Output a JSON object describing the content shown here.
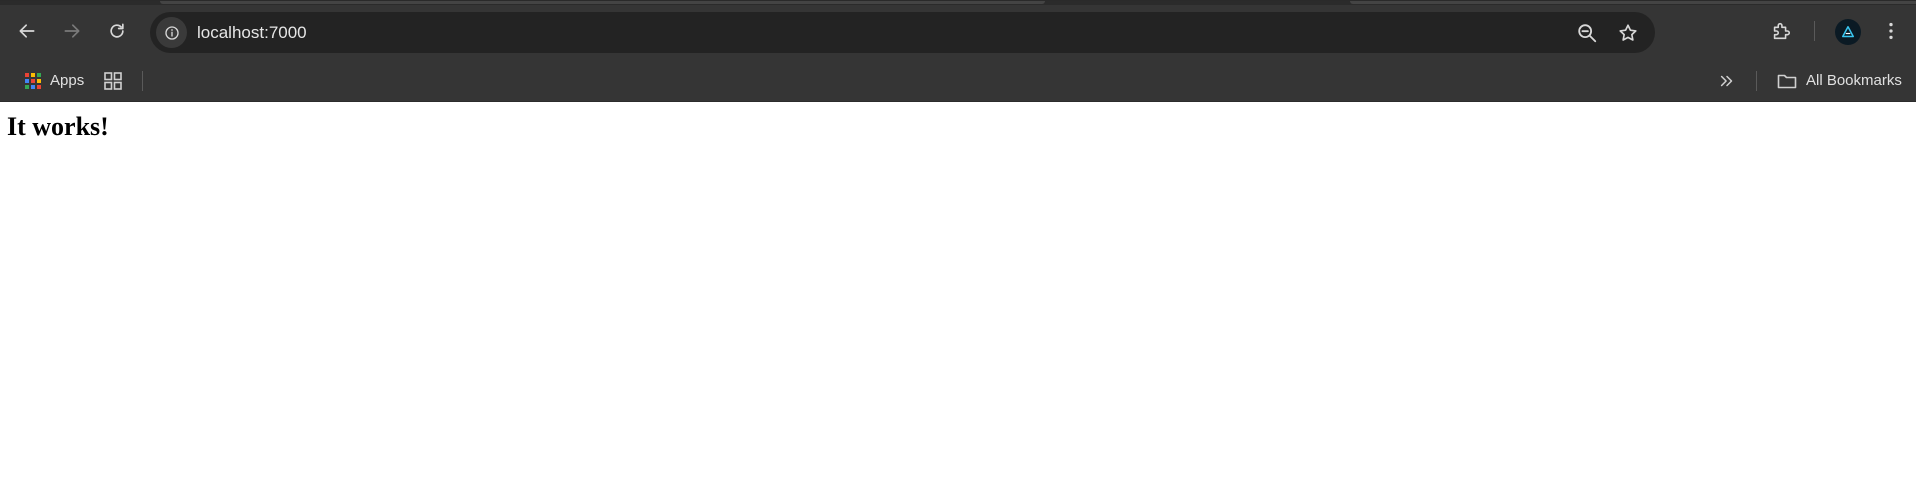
{
  "browser": {
    "omnibox": {
      "url": "localhost:7000"
    },
    "bookmarks": {
      "apps_label": "Apps",
      "all_bookmarks_label": "All Bookmarks"
    }
  },
  "page": {
    "heading": "It works!"
  }
}
